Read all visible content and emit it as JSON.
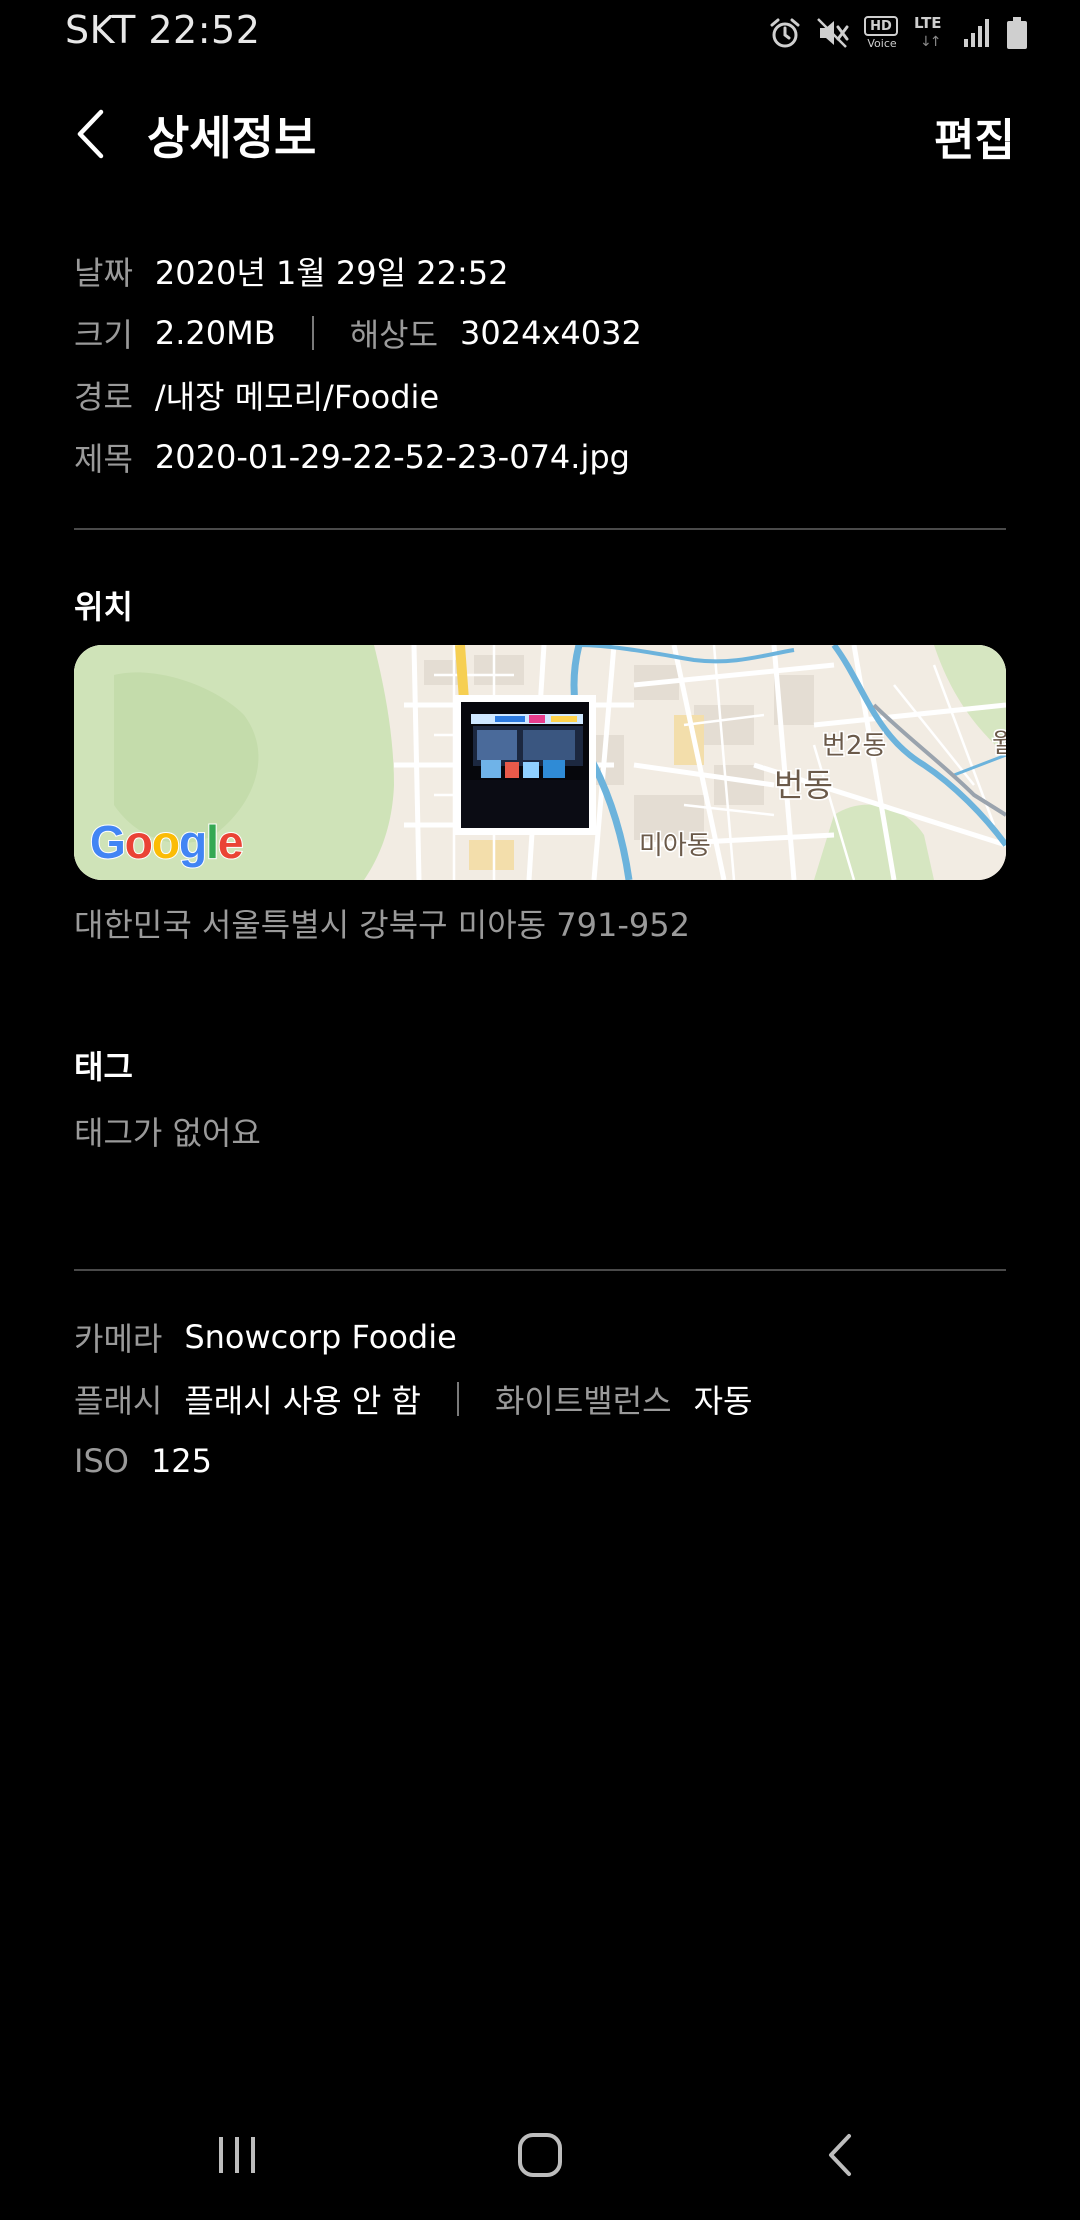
{
  "status_bar": {
    "carrier_time": "SKT 22:52",
    "icons": [
      "alarm-icon",
      "mute-icon",
      "hd-voice-icon",
      "lte-icon",
      "signal-icon",
      "battery-icon"
    ],
    "hd_label": "HD",
    "voice_label": "Voice",
    "lte_label": "LTE",
    "lte_arrows": "↓↑"
  },
  "header": {
    "title": "상세정보",
    "edit_label": "편집",
    "back_icon": "chevron-left-icon"
  },
  "details": {
    "date_label": "날짜",
    "date_value": "2020년 1월 29일 22:52",
    "size_label": "크기",
    "size_value": "2.20MB",
    "resolution_label": "해상도",
    "resolution_value": "3024x4032",
    "path_label": "경로",
    "path_value": "/내장 메모리/Foodie",
    "title_label": "제목",
    "title_value": "2020-01-29-22-52-23-074.jpg"
  },
  "location": {
    "heading": "위치",
    "map_labels": {
      "beon2dong": "번2동",
      "beondong": "번동",
      "miadong": "미아동",
      "edge": "월"
    },
    "google_logo": [
      "G",
      "o",
      "o",
      "g",
      "l",
      "e"
    ],
    "address": "대한민국 서울특별시 강북구 미아동 791-952"
  },
  "tags": {
    "heading": "태그",
    "empty_text": "태그가 없어요"
  },
  "camera": {
    "camera_label": "카메라",
    "camera_value": "Snowcorp Foodie",
    "flash_label": "플래시",
    "flash_value": "플래시 사용 안 함",
    "wb_label": "화이트밸런스",
    "wb_value": "자동",
    "iso_label": "ISO",
    "iso_value": "125"
  },
  "nav_bar": {
    "icons": [
      "recent-apps-icon",
      "home-icon",
      "back-icon"
    ]
  },
  "colors": {
    "background": "#000000",
    "label": "#9a9a9a",
    "value": "#ffffff",
    "divider": "#4a4a4a",
    "google_blue": "#4285F4",
    "google_red": "#EA4335",
    "google_yellow": "#FBBC05",
    "google_green": "#34A853"
  }
}
